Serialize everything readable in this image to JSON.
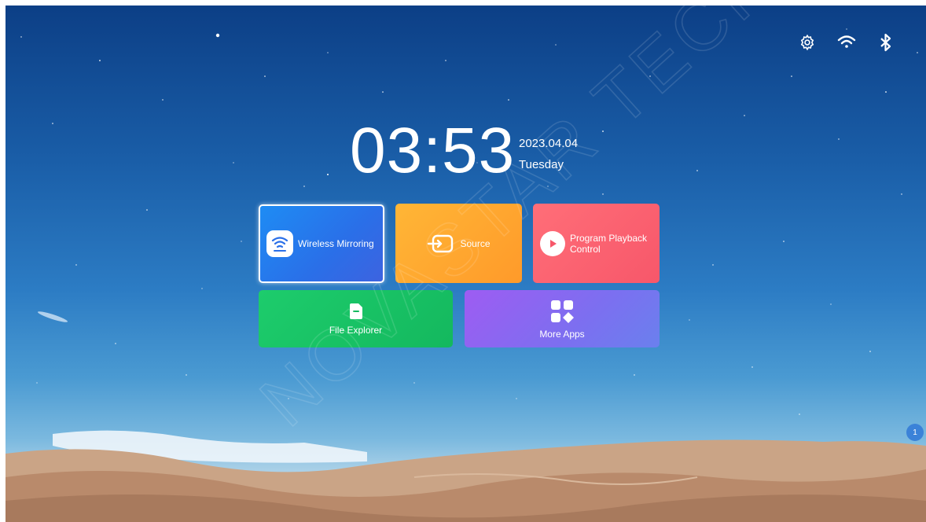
{
  "status_bar": {
    "icons": [
      "gear-icon",
      "wifi-icon",
      "bluetooth-icon"
    ]
  },
  "clock": {
    "time": "03:53",
    "date": "2023.04.04",
    "weekday": "Tuesday"
  },
  "tiles": {
    "wireless_mirroring": "Wireless Mirroring",
    "source": "Source",
    "program_playback_line1": "Program Playback",
    "program_playback_line2": "Control",
    "file_explorer": "File Explorer",
    "more_apps": "More Apps"
  },
  "notification_badge": "1",
  "watermark": "NOVASTAR TECH",
  "colors": {
    "wireless_mirroring": "#2a6fe8",
    "source": "#ffa52f",
    "program_playback": "#f7576a",
    "file_explorer": "#18c266",
    "more_apps": "#8a66f1"
  }
}
